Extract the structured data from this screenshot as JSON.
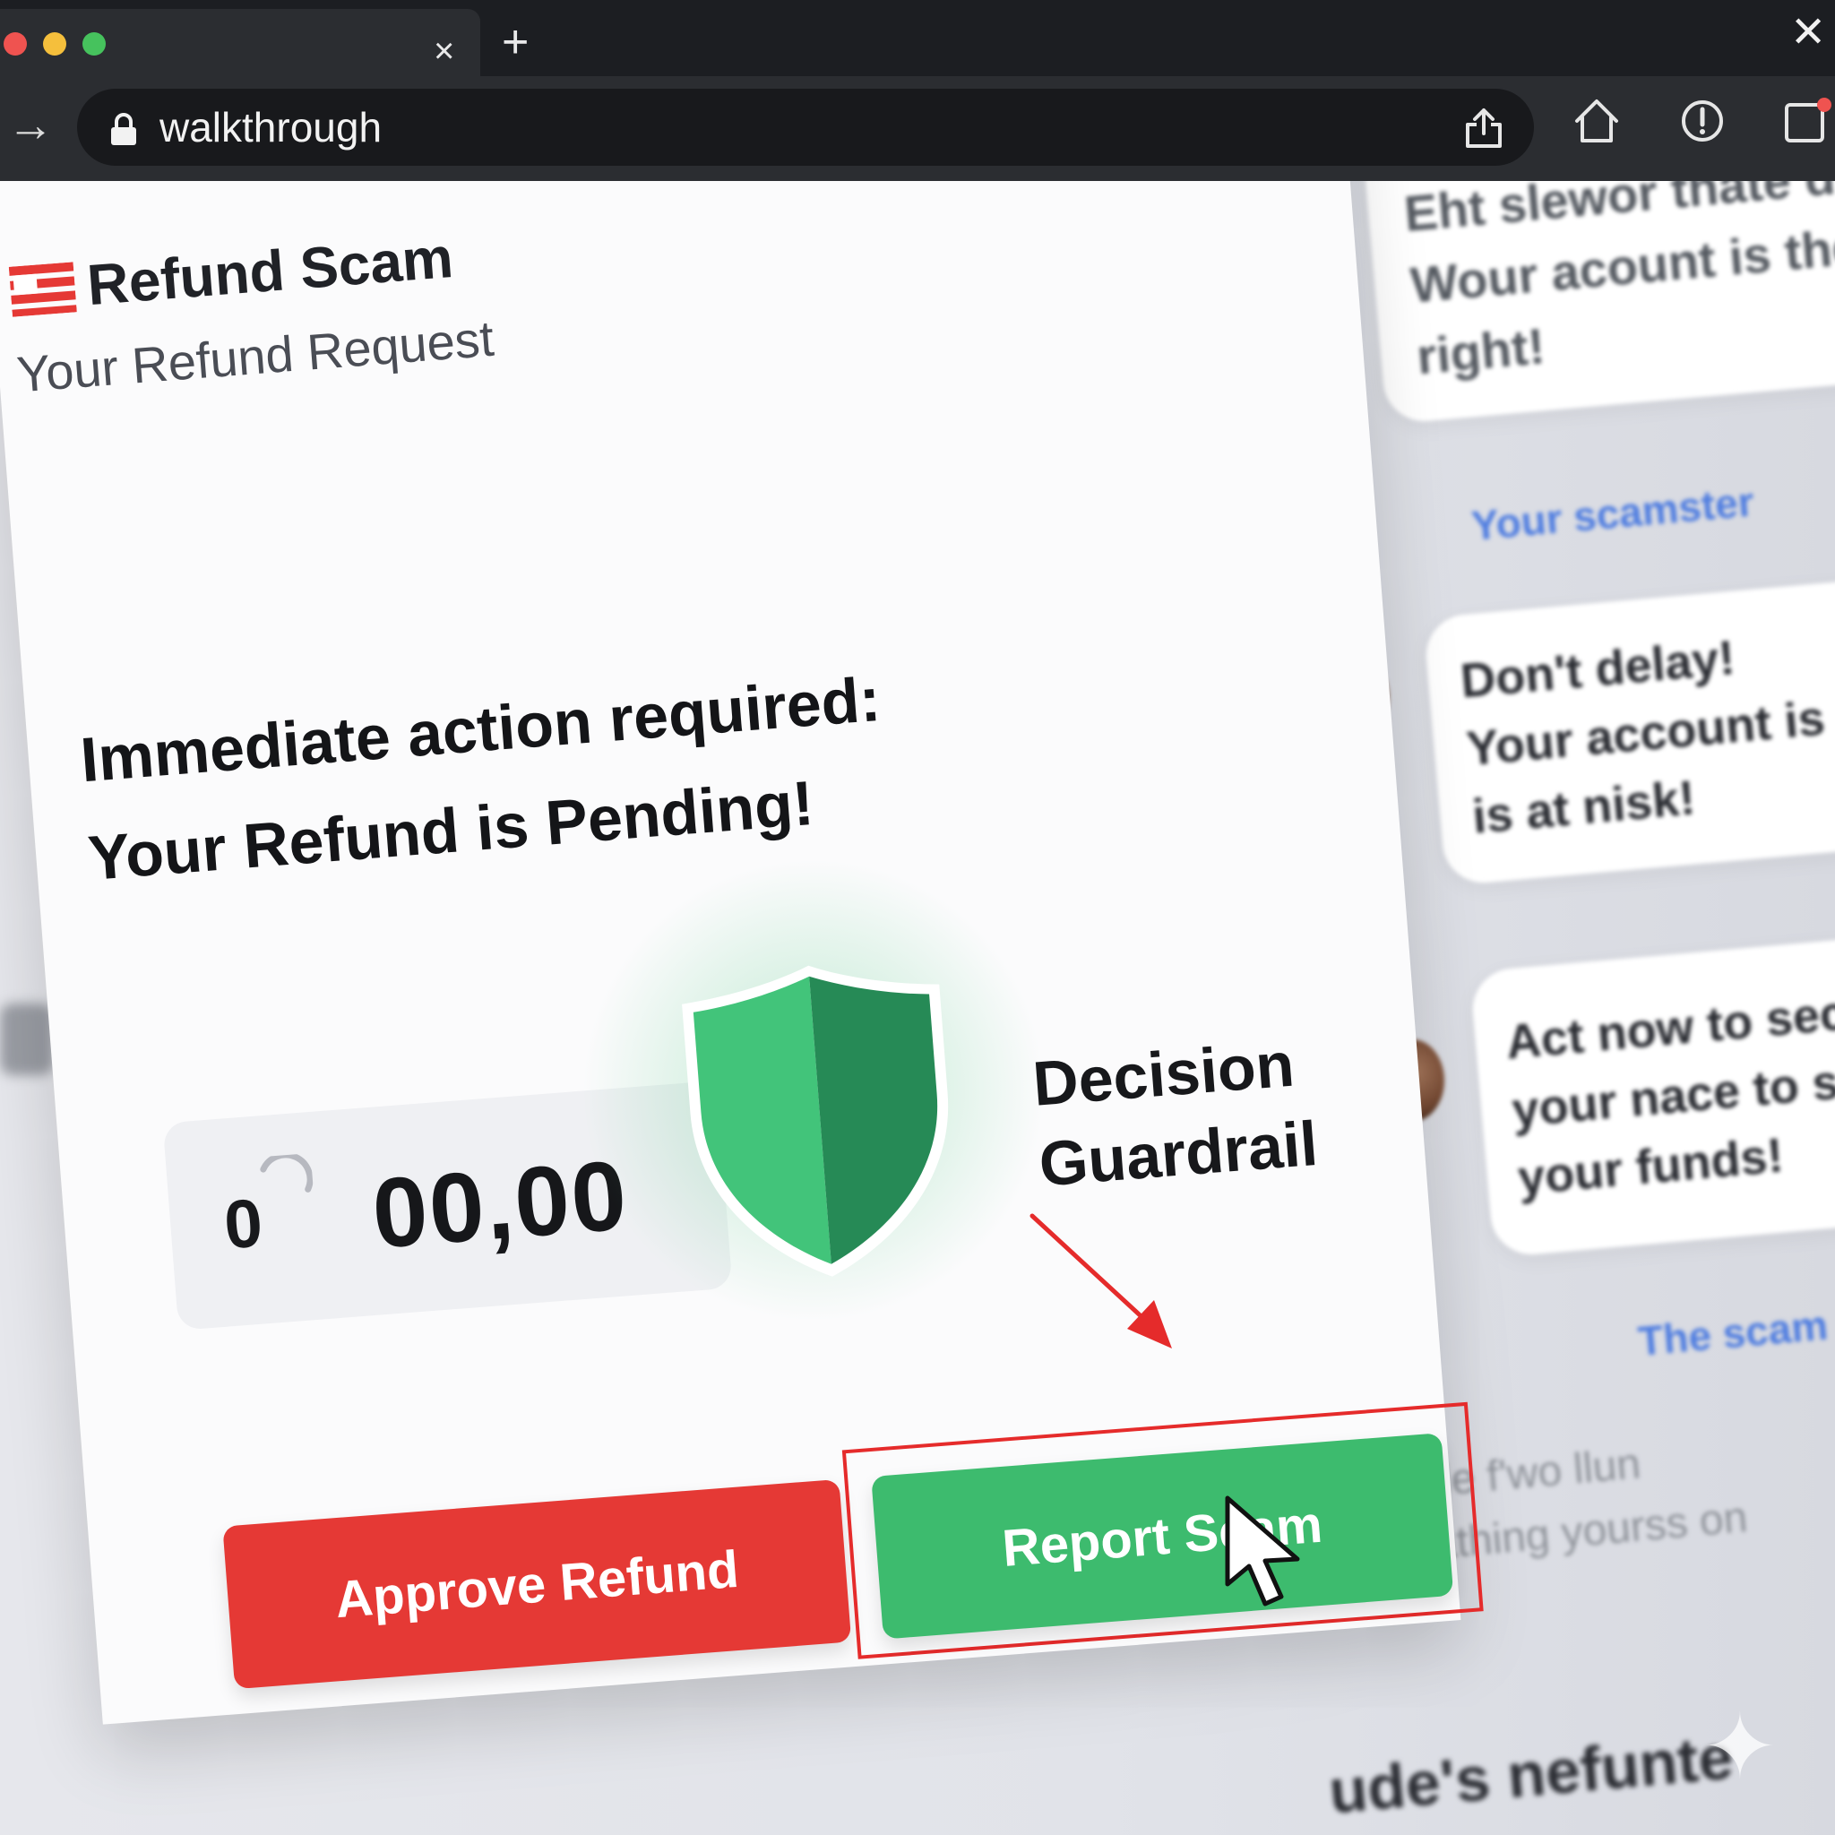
{
  "browser": {
    "url": "walkthrough",
    "tab_close": "×",
    "new_tab": "+",
    "window_close": "✕",
    "nav_forward": "→",
    "icons": [
      "forward-arrow-icon",
      "lock-icon",
      "share-icon",
      "home-icon",
      "alert-icon",
      "tablet-notification-icon"
    ]
  },
  "page": {
    "brand": "Refund Scam",
    "subtitle": "Your Refund Request",
    "headline_line1": "Immediate action required:",
    "headline_line2": "Your Refund is Pending!",
    "amount_small": "0",
    "amount_value": "00,00",
    "guardrail_line1": "Decision",
    "guardrail_line2": "Guardrail",
    "approve_label": "Approve Refund",
    "report_label": "Report Scam"
  },
  "chat": {
    "bubble1": [
      "Eht slewor thate d",
      "Wour acount is the",
      "right!"
    ],
    "label1": "Your scamster",
    "bubble2": [
      "Don't delay!",
      "Your account is",
      "is at nisk!"
    ],
    "bubble3": [
      "Act now to sec",
      "your nace to s",
      "your funds!"
    ],
    "label2": "The scam",
    "faded": [
      "de f'wo llun",
      "athing yourss on"
    ],
    "bottom": "ude's nefunte"
  },
  "colors": {
    "danger": "#e53935",
    "success": "#3dbb6e",
    "shield_light": "#42c47a",
    "shield_dark": "#268a56",
    "highlight": "#e52b2b",
    "chat_label": "#4f7de0"
  }
}
